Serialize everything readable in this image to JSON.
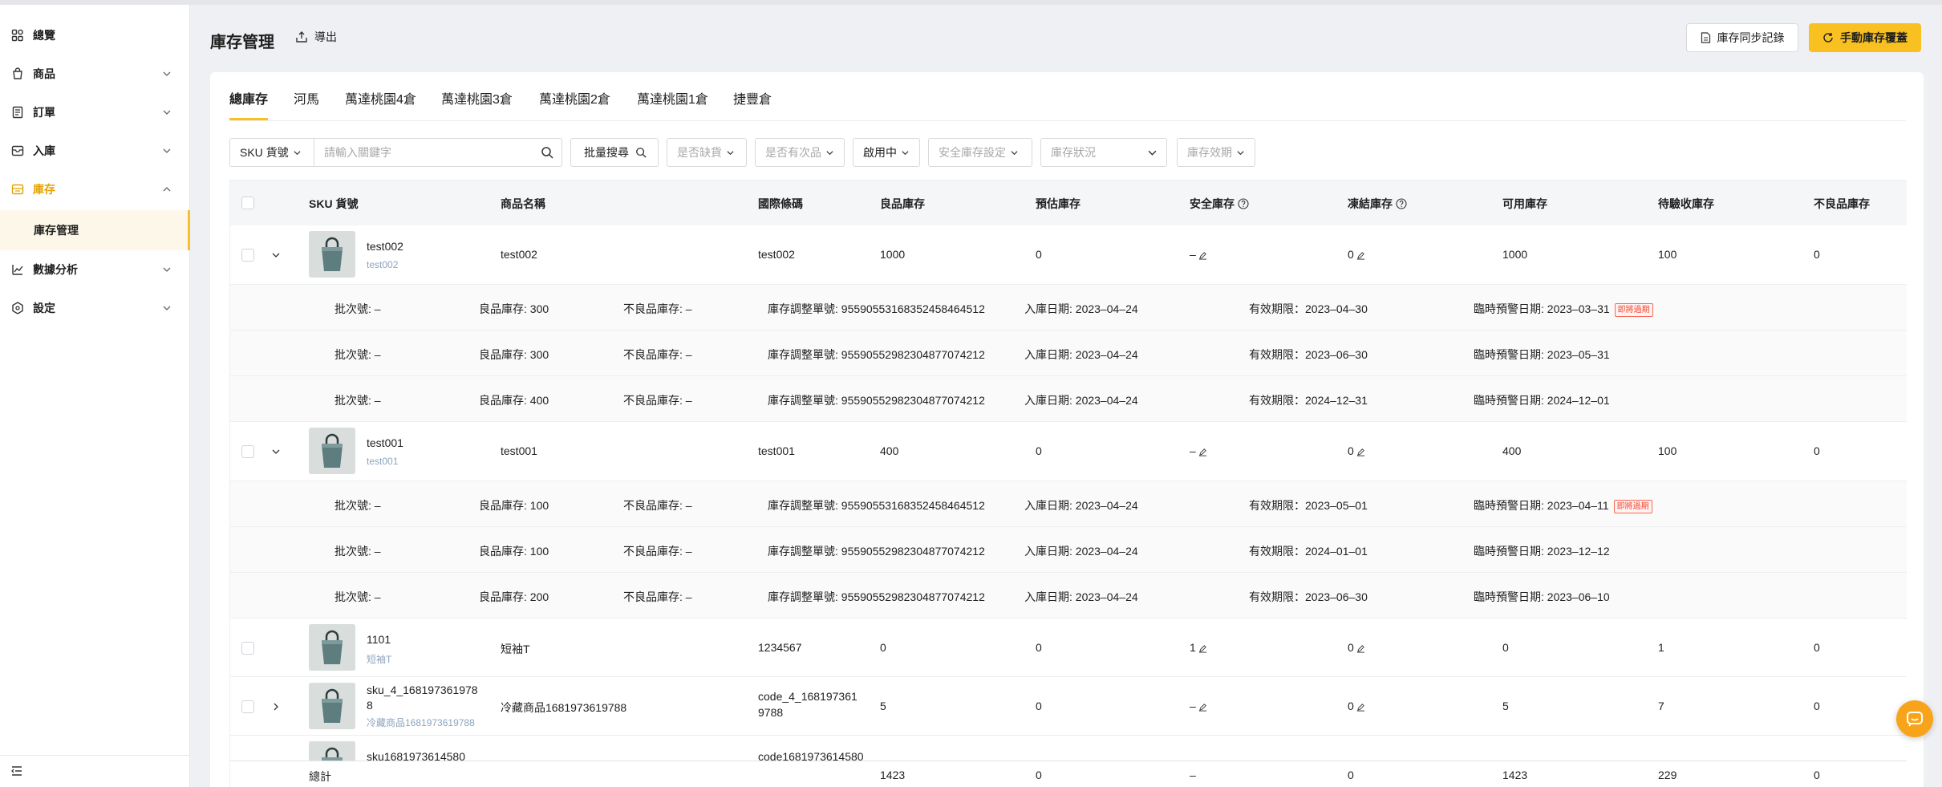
{
  "sidebar": {
    "items": [
      {
        "label": "總覽",
        "icon": "dashboard-icon"
      },
      {
        "label": "商品",
        "icon": "bag-icon"
      },
      {
        "label": "訂單",
        "icon": "receipt-icon"
      },
      {
        "label": "入庫",
        "icon": "inbox-icon"
      },
      {
        "label": "庫存",
        "icon": "warehouse-icon"
      },
      {
        "label": "數據分析",
        "icon": "chart-icon"
      },
      {
        "label": "設定",
        "icon": "hexagon-gear-icon"
      }
    ],
    "active_sub": "庫存管理",
    "accent": "#e5a300"
  },
  "header": {
    "title": "庫存管理",
    "export_label": "導出",
    "sync_label": "庫存同步記錄",
    "cover_label": "手動庫存覆蓋"
  },
  "tabs": [
    "總庫存",
    "河馬",
    "萬達桃園4倉",
    "萬達桃園3倉",
    "萬達桃園2倉",
    "萬達桃園1倉",
    "捷豐倉"
  ],
  "filters": {
    "sku_type": "SKU 貨號",
    "search_placeholder": "請輸入關鍵字",
    "batch_search": "批量搜尋",
    "out_of_stock": "是否缺貨",
    "has_defective": "是否有次品",
    "enabled": "啟用中",
    "safety_setting": "安全庫存設定",
    "stock_status": "庫存狀況",
    "expiry": "庫存效期"
  },
  "columns": [
    "SKU 貨號",
    "商品名稱",
    "國際條碼",
    "良品庫存",
    "預估庫存",
    "安全庫存",
    "凍結庫存",
    "可用庫存",
    "待驗收庫存",
    "不良品庫存"
  ],
  "products": [
    {
      "sku": "test002",
      "sku_sub": "test002",
      "name": "test002",
      "barcode": "test002",
      "good": "1000",
      "est": "0",
      "safety": "–",
      "frozen": "0",
      "avail": "1000",
      "pending": "100",
      "defective": "0",
      "batches": [
        {
          "batch": "批次號: –",
          "good": "良品庫存: 300",
          "bad": "不良品庫存: –",
          "adj": "庫存調整單號: 9559055316835245846451​2",
          "in": "入庫日期: 2023–04–24",
          "exp": "有效期限：2023–04–30",
          "warn": "臨時預警日期: 2023–03–31",
          "tag": "即將過期"
        },
        {
          "batch": "批次號: –",
          "good": "良品庫存: 300",
          "bad": "不良品庫存: –",
          "adj": "庫存調整單號: 9559055298230487707421​2",
          "in": "入庫日期: 2023–04–24",
          "exp": "有效期限：2023–06–30",
          "warn": "臨時預警日期: 2023–05–31",
          "tag": ""
        },
        {
          "batch": "批次號: –",
          "good": "良品庫存: 400",
          "bad": "不良品庫存: –",
          "adj": "庫存調整單號: 9559055298230487707421​2",
          "in": "入庫日期: 2023–04–24",
          "exp": "有效期限：2024–12–31",
          "warn": "臨時預警日期: 2024–12–01",
          "tag": ""
        }
      ]
    },
    {
      "sku": "test001",
      "sku_sub": "test001",
      "name": "test001",
      "barcode": "test001",
      "good": "400",
      "est": "0",
      "safety": "–",
      "frozen": "0",
      "avail": "400",
      "pending": "100",
      "defective": "0",
      "batches": [
        {
          "batch": "批次號: –",
          "good": "良品庫存: 100",
          "bad": "不良品庫存: –",
          "adj": "庫存調整單號: 9559055316835245846451​2",
          "in": "入庫日期: 2023–04–24",
          "exp": "有效期限：2023–05–01",
          "warn": "臨時預警日期: 2023–04–11",
          "tag": "即將過期"
        },
        {
          "batch": "批次號: –",
          "good": "良品庫存: 100",
          "bad": "不良品庫存: –",
          "adj": "庫存調整單號: 9559055298230487707421​2",
          "in": "入庫日期: 2023–04–24",
          "exp": "有效期限：2024–01–01",
          "warn": "臨時預警日期: 2023–12–12",
          "tag": ""
        },
        {
          "batch": "批次號: –",
          "good": "良品庫存: 200",
          "bad": "不良品庫存: –",
          "adj": "庫存調整單號: 9559055298230487707421​2",
          "in": "入庫日期: 2023–04–24",
          "exp": "有效期限：2023–06–30",
          "warn": "臨時預警日期: 2023–06–10",
          "tag": ""
        }
      ]
    },
    {
      "sku": "1101",
      "sku_sub": "短袖T",
      "name": "短袖T",
      "barcode": "1234567",
      "good": "0",
      "est": "0",
      "safety": "1",
      "frozen": "0",
      "avail": "0",
      "pending": "1",
      "defective": "0"
    },
    {
      "sku": "sku_4_168197361978",
      "sku2": "8",
      "sku_sub": "冷藏商品1681973619788",
      "name": "冷藏商品1681973619788",
      "barcode": "code_4_168197361",
      "barcode2": "9788",
      "good": "5",
      "est": "0",
      "safety": "–",
      "frozen": "0",
      "avail": "5",
      "pending": "7",
      "defective": "0"
    },
    {
      "sku": "sku1681973614580",
      "barcode": "code1681973614580"
    }
  ],
  "totals": {
    "label": "總計",
    "good": "1423",
    "est": "0",
    "safety": "–",
    "frozen": "0",
    "avail": "1423",
    "pending": "229",
    "defective": "0"
  }
}
